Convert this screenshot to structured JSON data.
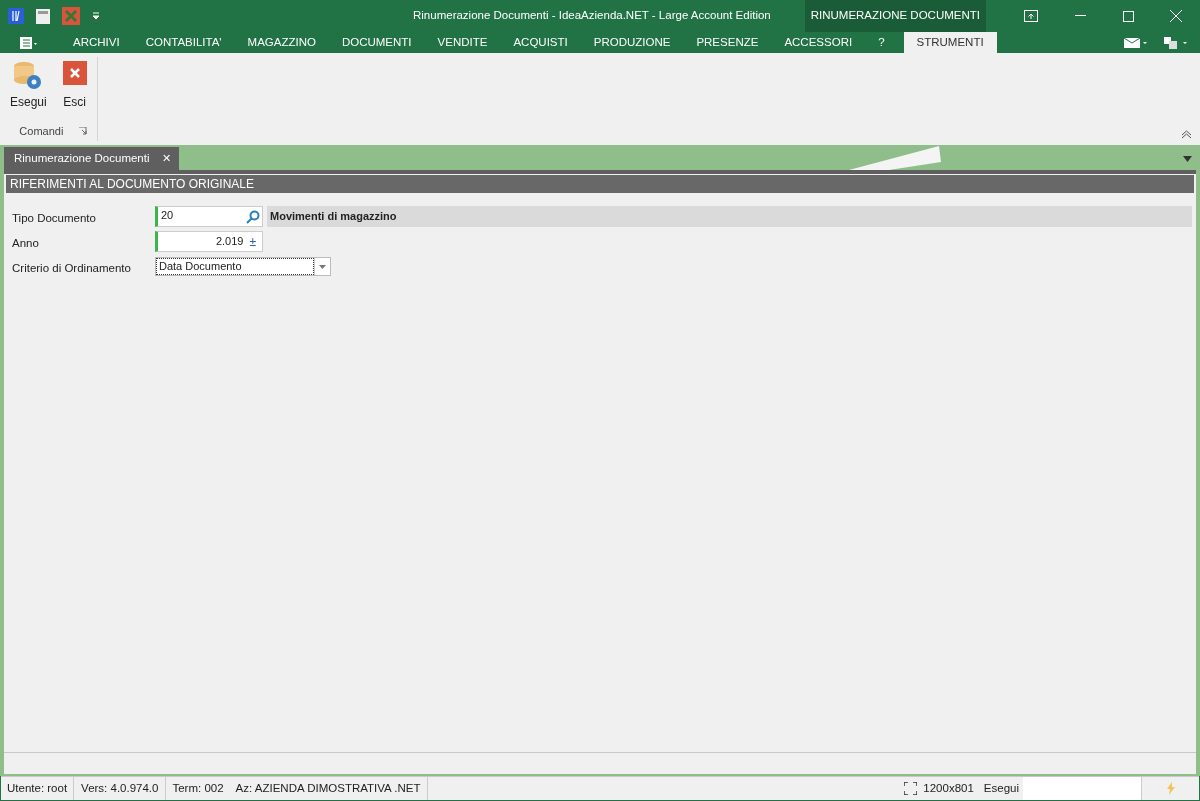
{
  "window": {
    "title": "Rinumerazione Documenti - IdeaAzienda.NET - Large Account Edition",
    "context_tab": "RINUMERAZIONE DOCUMENTI"
  },
  "menu": [
    {
      "label": "ARCHIVI",
      "selected": false
    },
    {
      "label": "CONTABILITA'",
      "selected": false
    },
    {
      "label": "MAGAZZINO",
      "selected": false
    },
    {
      "label": "DOCUMENTI",
      "selected": false
    },
    {
      "label": "VENDITE",
      "selected": false
    },
    {
      "label": "ACQUISTI",
      "selected": false
    },
    {
      "label": "PRODUZIONE",
      "selected": false
    },
    {
      "label": "PRESENZE",
      "selected": false
    },
    {
      "label": "ACCESSORI",
      "selected": false
    },
    {
      "label": "?",
      "selected": false
    },
    {
      "label": "STRUMENTI",
      "selected": true
    }
  ],
  "ribbon": {
    "buttons": [
      {
        "label": "Esegui",
        "kind": "run"
      },
      {
        "label": "Esci",
        "kind": "exit"
      }
    ],
    "group": "Comandi"
  },
  "document_tab": {
    "label": "Rinumerazione Documenti",
    "close": "✕"
  },
  "section": {
    "title": "RIFERIMENTI AL DOCUMENTO ORIGINALE"
  },
  "form": [
    {
      "kind": "lookup",
      "label": "Tipo Documento",
      "value": "20",
      "description": "Movimenti di magazzino"
    },
    {
      "kind": "number",
      "label": "Anno",
      "value": "2.019",
      "button": "±"
    },
    {
      "kind": "select",
      "label": "Criterio di Ordinamento",
      "value": "Data Documento"
    }
  ],
  "status_bar": {
    "user": "Utente: root",
    "version": "Vers: 4.0.974.0",
    "terminal": "Term: 002",
    "company": "Az: AZIENDA DIMOSTRATIVA .NET",
    "resolution": "1200x801",
    "command_label": "Esegui"
  }
}
